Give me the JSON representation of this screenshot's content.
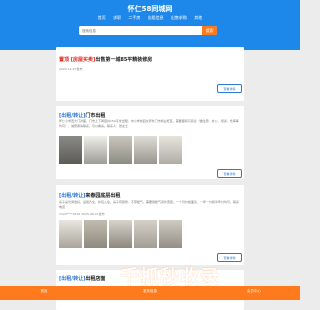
{
  "header": {
    "site_name": "怀仁58同城网",
    "nav": [
      "首页",
      "求职",
      "二手房",
      "出租信息",
      "出售求购",
      "其他"
    ],
    "search_placeholder": "搜索信息",
    "search_button": "搜索"
  },
  "posts": [
    {
      "tag": "置顶",
      "category": "[房屋买卖]",
      "title": "出售第一城85平精装修房",
      "desc": "",
      "time": "2024-12-27发布",
      "detail_label": "查看详情"
    },
    {
      "tag": "",
      "category": "[出租/转让]",
      "title": "门市出租",
      "desc": "怀仁小学西大门对面，门市上下两层共150平米出租，中小学校园交界处门市商业旺区，需要面积可另议（做生意、办公、培训、仓库等均可），诚意者请联系，可以看房。联系人：张女士",
      "time": "1521360****2025-06-01发布",
      "detail_label": "查看详情"
    },
    {
      "tag": "",
      "category": "[出租/转让]",
      "title": "来春园底层出租",
      "desc": "房子采光通透好，设施齐全，拎包入住，房子有装修，不带暖气，需要用暖气另外安装，一个月价格面谈，一年一付和半年付均可，联系电话",
      "time": "1324****3425 2025-06-07发布",
      "detail_label": "查看详情"
    },
    {
      "tag": "",
      "category": "[出租/转让]",
      "title": "出租店面",
      "desc": "",
      "time": "",
      "detail_label": ""
    }
  ],
  "footer": {
    "items": [
      "首页",
      "发布信息",
      "会员中心"
    ]
  },
  "watermark": "千抓秒收录"
}
